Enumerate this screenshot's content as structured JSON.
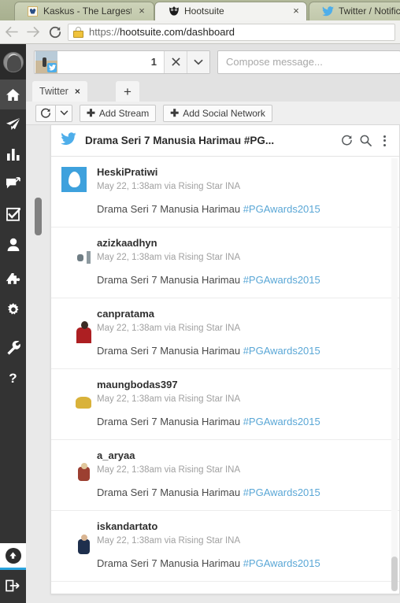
{
  "browser": {
    "tabs": [
      {
        "label": "Kaskus - The Largest Indo",
        "favicon": "kaskus-icon",
        "active": false,
        "close_label": "×"
      },
      {
        "label": "Hootsuite",
        "favicon": "owl-icon",
        "active": true,
        "close_label": "×"
      },
      {
        "label": "Twitter / Notifica",
        "favicon": "twitter-bird-icon",
        "active": false,
        "close_label": ""
      }
    ],
    "toolbar": {
      "back_icon": "arrow-left-icon",
      "forward_icon": "arrow-right-icon",
      "reload_icon": "reload-icon",
      "security_icon": "warning-lock-icon",
      "url_scheme": "https://",
      "url_host": "hootsuite.com",
      "url_path": "/dashboard",
      "url_full": "https://hootsuite.com/dashboard"
    }
  },
  "sidebar": {
    "avatar_name": "user-avatar",
    "items": [
      {
        "label": "Streams",
        "icon": "home-icon",
        "active": true
      },
      {
        "label": "Publisher",
        "icon": "paper-plane-icon",
        "active": false
      },
      {
        "label": "Analytics",
        "icon": "bar-chart-icon",
        "active": false
      },
      {
        "label": "Assignments",
        "icon": "comment-reply-icon",
        "active": false
      },
      {
        "label": "Tasks",
        "icon": "checkbox-icon",
        "active": false
      },
      {
        "label": "Contacts",
        "icon": "person-icon",
        "active": false
      },
      {
        "label": "App Directory",
        "icon": "puzzle-piece-icon",
        "active": false
      },
      {
        "label": "Settings",
        "icon": "gear-icon",
        "active": false
      },
      {
        "label": "Tools",
        "icon": "wrench-icon",
        "active": false
      },
      {
        "label": "Help",
        "icon": "question-mark-icon",
        "active": false
      }
    ],
    "collapse": {
      "label": "Collapse",
      "icon": "circle-up-arrow-icon",
      "accent": "#2aa3dd"
    },
    "logout": {
      "label": "Sign out",
      "icon": "sign-out-icon"
    }
  },
  "topbar": {
    "profile_selector": {
      "thumb_name": "social-profile-thumbnail",
      "network_badge": "twitter-bird-icon",
      "count": "1",
      "clear_label": "×",
      "expand_icon": "chevron-down-icon"
    },
    "compose": {
      "placeholder": "Compose message...",
      "value": ""
    }
  },
  "tabs_row": {
    "tabs": [
      {
        "label": "Twitter",
        "close_label": "×",
        "active": true
      }
    ],
    "add_tab_label": "+"
  },
  "actionbar": {
    "refresh_icon": "refresh-icon",
    "refresh_caret_icon": "chevron-down-icon",
    "add_stream_label": "Add Stream",
    "add_social_network_label": "Add Social Network",
    "plus_glyph": "✚"
  },
  "stream": {
    "network_icon": "twitter-bird-icon",
    "title": "Drama Seri 7 Manusia Harimau #PG...",
    "actions": [
      {
        "label": "Refresh",
        "icon": "refresh-icon"
      },
      {
        "label": "Search",
        "icon": "search-icon"
      },
      {
        "label": "More options",
        "icon": "kebab-menu-icon"
      }
    ],
    "tweets": [
      {
        "user": "HeskiPratiwi",
        "meta": "May 22, 1:38am via Rising Star INA",
        "text": "Drama Seri 7 Manusia Harimau ",
        "hashtag": "#PGAwards2015",
        "avatar": "av-egg"
      },
      {
        "user": "azizkaadhyn",
        "meta": "May 22, 1:38am via Rising Star INA",
        "text": "Drama Seri 7 Manusia Harimau ",
        "hashtag": "#PGAwards2015",
        "avatar": "av-snow"
      },
      {
        "user": "canpratama",
        "meta": "May 22, 1:38am via Rising Star INA",
        "text": "Drama Seri 7 Manusia Harimau ",
        "hashtag": "#PGAwards2015",
        "avatar": "av-red"
      },
      {
        "user": "maungbodas397",
        "meta": "May 22, 1:38am via Rising Star INA",
        "text": "Drama Seri 7 Manusia Harimau ",
        "hashtag": "#PGAwards2015",
        "avatar": "av-neon"
      },
      {
        "user": "a_aryaa",
        "meta": "May 22, 1:38am via Rising Star INA",
        "text": "Drama Seri 7 Manusia Harimau ",
        "hashtag": "#PGAwards2015",
        "avatar": "av-dark"
      },
      {
        "user": "iskandartato",
        "meta": "May 22, 1:38am via Rising Star INA",
        "text": "Drama Seri 7 Manusia Harimau ",
        "hashtag": "#PGAwards2015",
        "avatar": "av-blue"
      }
    ]
  },
  "colors": {
    "twitter_blue": "#4eaeea",
    "hashtag_link": "#5aa7d6",
    "sidebar_bg": "#333333",
    "accent": "#2aa3dd"
  }
}
